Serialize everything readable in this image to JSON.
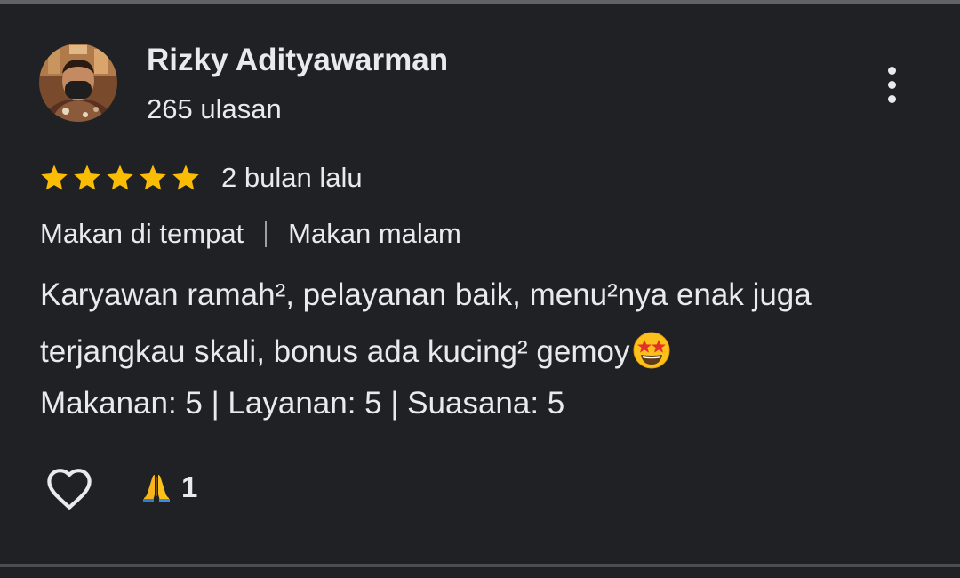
{
  "review": {
    "reviewer": {
      "name": "Rizky Adityawarman",
      "review_count": "265 ulasan",
      "avatar_icon": "reviewer-photo"
    },
    "rating": 5,
    "rating_max": 5,
    "date": "2 bulan lalu",
    "tags": [
      "Makan di tempat",
      "Makan malam"
    ],
    "text_line_1": "Karyawan ramah², pelayanan baik, menu²nya enak juga",
    "text_line_2": "terjangkau skali, bonus ada kucing² gemoy",
    "text_emoji": "star-struck-emoji",
    "aspect_ratings": "Makanan: 5 | Layanan: 5 | Suasana: 5",
    "reactions": {
      "like_icon": "heart-outline-icon",
      "reaction_icon": "folded-hands-emoji",
      "reaction_count": "1"
    }
  },
  "colors": {
    "background": "#202124",
    "text": "#e8eaed",
    "star": "#fbbc04",
    "divider": "#5f6368"
  }
}
